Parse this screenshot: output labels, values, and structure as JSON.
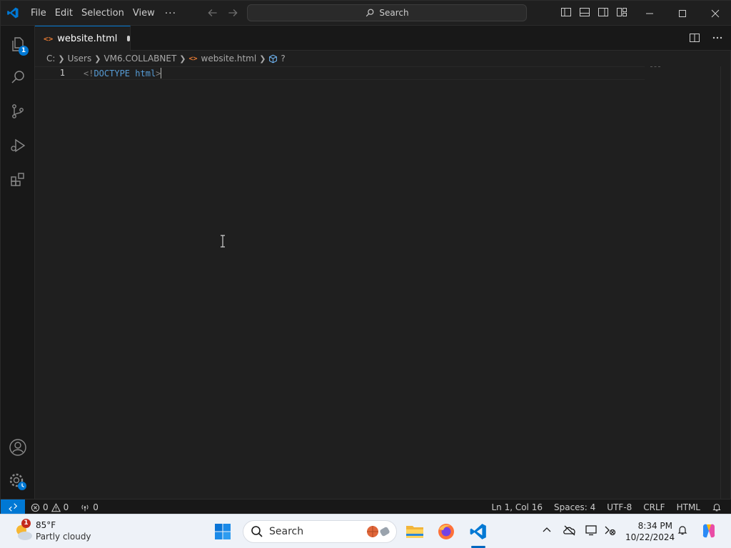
{
  "menu": {
    "items": [
      "File",
      "Edit",
      "Selection",
      "View"
    ],
    "more": "···"
  },
  "search": {
    "label": "Search"
  },
  "activity": {
    "explorer_badge": "1"
  },
  "tab": {
    "filename": "website.html",
    "icon_text": "<>"
  },
  "breadcrumb": {
    "parts": [
      "C:",
      "Users",
      "VM6.COLLABNET"
    ],
    "file": "website.html",
    "symbol": "?"
  },
  "editor": {
    "line_number": "1",
    "code_open": "<!",
    "code_keyword": "DOCTYPE",
    "code_space": " ",
    "code_tag": "html",
    "code_close": ">"
  },
  "status": {
    "errors": "0",
    "warnings": "0",
    "ports": "0",
    "position": "Ln 1, Col 16",
    "spaces": "Spaces: 4",
    "encoding": "UTF-8",
    "eol": "CRLF",
    "language": "HTML"
  },
  "taskbar": {
    "weather_temp": "85°F",
    "weather_desc": "Partly cloudy",
    "weather_badge": "1",
    "search_label": "Search",
    "time": "8:34 PM",
    "date": "10/22/2024"
  },
  "colors": {
    "accent": "#0078d4",
    "html_icon": "#e37933",
    "keyword": "#569cd6"
  }
}
